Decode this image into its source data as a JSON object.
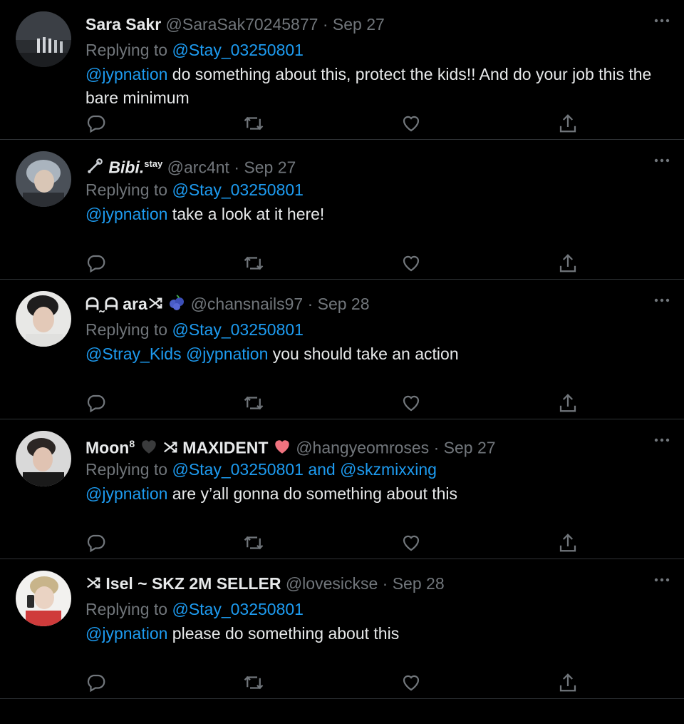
{
  "accent": "#1d9bf0",
  "replying_prefix": "Replying to",
  "tweets": [
    {
      "name": "Sara Sakr",
      "handle": "@SaraSak70245877",
      "date": "· Sep 27",
      "reply_to": "@Stay_03250801",
      "mentions": "@jypnation",
      "text": " do something about this, protect the kids!! And do your job this the bare minimum"
    },
    {
      "name": "Bibi.",
      "name_sup": "stay",
      "handle": "@arc4nt",
      "date": "· Sep 27",
      "reply_to": "@Stay_03250801",
      "mentions": "@jypnation",
      "text": " take a look at it here!"
    },
    {
      "name": "ara",
      "name_prefix": "ᗩ˷ᗩ",
      "handle": "@chansnails97",
      "date": "· Sep 28",
      "reply_to": "@Stay_03250801",
      "mentions": "@Stray_Kids @jypnation",
      "text": " you should take an action"
    },
    {
      "name": "Moon",
      "name_sup": "8",
      "name2": "MAXIDENT",
      "handle": "@hangyeomroses",
      "date": "· Sep 27",
      "reply_to": "@Stay_03250801 and @skzmixxing",
      "mentions": "@jypnation",
      "text": " are y’all gonna do something about this"
    },
    {
      "name": "Isel ~ SKZ 2M SELLER",
      "handle": "@lovesickse",
      "date": "· Sep 28",
      "reply_to": "@Stay_03250801",
      "mentions": "@jypnation",
      "text": " please do something about this"
    }
  ]
}
